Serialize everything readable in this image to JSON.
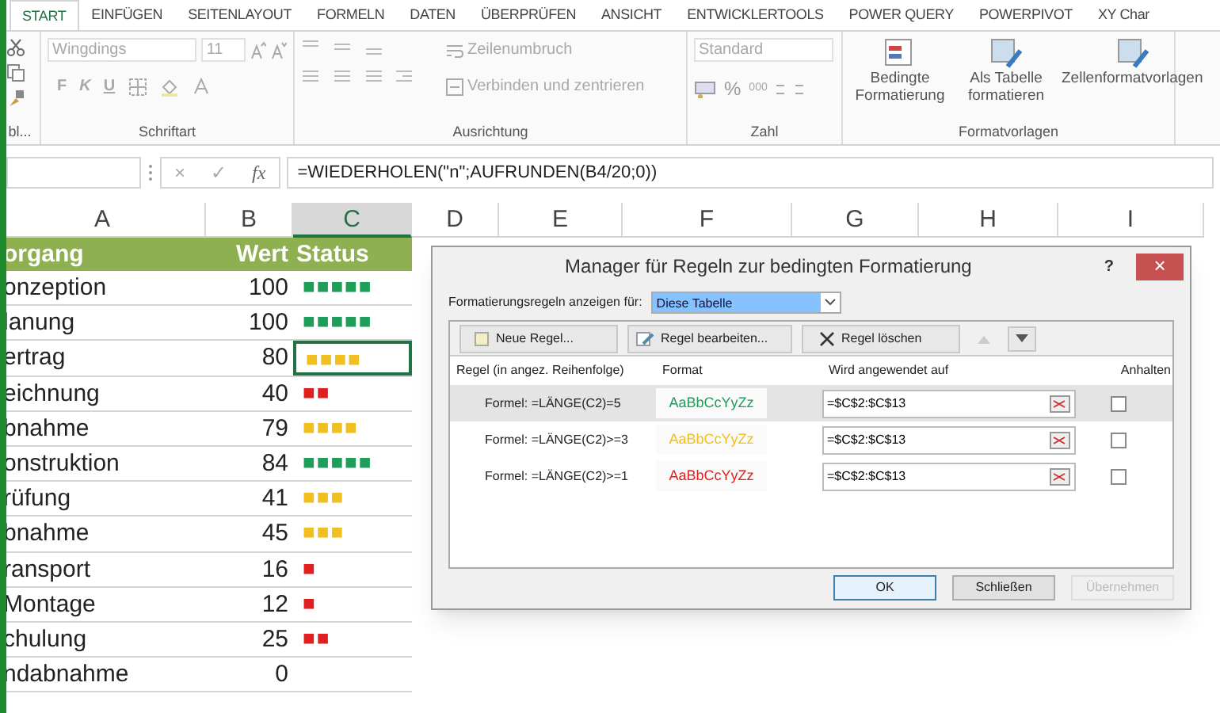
{
  "tabs": [
    {
      "label": "START",
      "selected": true
    },
    {
      "label": "EINFÜGEN",
      "selected": false
    },
    {
      "label": "SEITENLAYOUT",
      "selected": false
    },
    {
      "label": "FORMELN",
      "selected": false
    },
    {
      "label": "DATEN",
      "selected": false
    },
    {
      "label": "ÜBERPRÜFEN",
      "selected": false
    },
    {
      "label": "ANSICHT",
      "selected": false
    },
    {
      "label": "ENTWICKLERTOOLS",
      "selected": false
    },
    {
      "label": "POWER QUERY",
      "selected": false
    },
    {
      "label": "POWERPIVOT",
      "selected": false
    },
    {
      "label": "XY Char",
      "selected": false
    }
  ],
  "ribbon": {
    "clipboard_label": "bl...",
    "font": {
      "name": "Wingdings",
      "size": "11",
      "style_buttons": [
        "F",
        "K",
        "U"
      ],
      "label": "Schriftart"
    },
    "alignment": {
      "wrap": "Zeilenumbruch",
      "merge": "Verbinden und zentrieren",
      "label": "Ausrichtung"
    },
    "number": {
      "format": "Standard",
      "percent": "%",
      "thousands": "000",
      "label": "Zahl"
    },
    "styles": {
      "buttons": [
        "Bedingte Formatierung",
        "Als Tabelle formatieren",
        "Zellenformatvorlagen"
      ],
      "label": "Formatvorlagen"
    }
  },
  "formula_bar": {
    "cancel": "×",
    "enter": "✓",
    "fx": "fx",
    "formula": "=WIEDERHOLEN(\"n\";AUFRUNDEN(B4/20;0))"
  },
  "columns": [
    {
      "label": "A",
      "selected": false
    },
    {
      "label": "B",
      "selected": false
    },
    {
      "label": "C",
      "selected": true
    },
    {
      "label": "D",
      "selected": false
    },
    {
      "label": "E",
      "selected": false
    },
    {
      "label": "F",
      "selected": false
    },
    {
      "label": "G",
      "selected": false
    },
    {
      "label": "H",
      "selected": false
    },
    {
      "label": "I",
      "selected": false
    }
  ],
  "table_header": [
    "organg",
    "Wert",
    "Status"
  ],
  "rows": [
    {
      "name": "onzeption",
      "value": "100",
      "status": "■■■■■",
      "color": "#1e9e58",
      "selected": false
    },
    {
      "name": "lanung",
      "value": "100",
      "status": "■■■■■",
      "color": "#1e9e58",
      "selected": false
    },
    {
      "name": "ertrag",
      "value": "80",
      "status": "■■■■",
      "color": "#f0c020",
      "selected": true
    },
    {
      "name": "eichnung",
      "value": "40",
      "status": "■■",
      "color": "#e02020",
      "selected": false
    },
    {
      "name": "bnahme",
      "value": "79",
      "status": "■■■■",
      "color": "#f0c020",
      "selected": false
    },
    {
      "name": "onstruktion",
      "value": "84",
      "status": "■■■■■",
      "color": "#1e9e58",
      "selected": false
    },
    {
      "name": "rüfung",
      "value": "41",
      "status": "■■■",
      "color": "#f0c020",
      "selected": false
    },
    {
      "name": "bnahme",
      "value": "45",
      "status": "■■■",
      "color": "#f0c020",
      "selected": false
    },
    {
      "name": "ransport",
      "value": "16",
      "status": "■",
      "color": "#e02020",
      "selected": false
    },
    {
      "name": "Montage",
      "value": "12",
      "status": "■",
      "color": "#e02020",
      "selected": false
    },
    {
      "name": "chulung",
      "value": "25",
      "status": "■■",
      "color": "#e02020",
      "selected": false
    },
    {
      "name": "ndabnahme",
      "value": "0",
      "selected": false
    }
  ],
  "dialog": {
    "title": "Manager für Regeln zur bedingten Formatierung",
    "help": "?",
    "close": "×",
    "scope_label": "Formatierungsregeln anzeigen für:",
    "scope": "Diese Tabelle",
    "toolbar": [
      {
        "kind": "new",
        "label": "Neue Regel..."
      },
      {
        "kind": "edit",
        "label": "Regel bearbeiten..."
      },
      {
        "kind": "delete",
        "label": "Regel löschen"
      },
      {
        "kind": "up",
        "disabled": true
      },
      {
        "kind": "down",
        "disabled": false
      }
    ],
    "columns": [
      "Regel (in angez. Reihenfolge)",
      "Format",
      "Wird angewendet auf",
      "Anhalten"
    ],
    "rules": [
      {
        "rule": "Formel: =LÄNGE(C2)=5",
        "preview": "AaBbCcYyZz",
        "color": "#1e9e58",
        "applies_to": "=$C$2:$C$13",
        "checked": false,
        "selected": true
      },
      {
        "rule": "Formel: =LÄNGE(C2)>=3",
        "preview": "AaBbCcYyZz",
        "color": "#f0c020",
        "applies_to": "=$C$2:$C$13",
        "checked": false,
        "selected": false
      },
      {
        "rule": "Formel: =LÄNGE(C2)>=1",
        "preview": "AaBbCcYyZz",
        "color": "#e02020",
        "applies_to": "=$C$2:$C$13",
        "checked": false,
        "selected": false
      }
    ],
    "buttons": [
      {
        "label": "OK",
        "disabled": false,
        "default": true
      },
      {
        "label": "Schließen",
        "disabled": false,
        "default": false
      },
      {
        "label": "Übernehmen",
        "disabled": true,
        "default": false
      }
    ]
  }
}
